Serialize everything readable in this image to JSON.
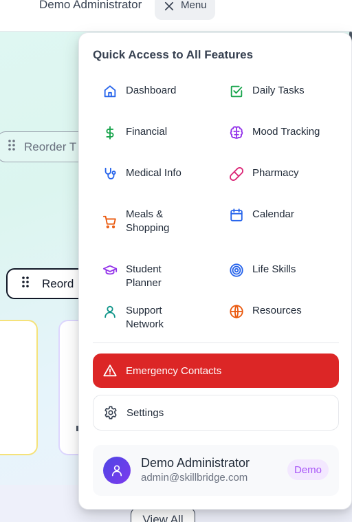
{
  "header": {
    "user_name": "Demo Administrator",
    "menu_label": "Menu"
  },
  "background": {
    "reorder_label_1": "Reorder T",
    "reorder_label_2": "Reord",
    "view_all_label": "View All"
  },
  "menu": {
    "title": "Quick Access to All Features",
    "items": [
      {
        "label": "Dashboard",
        "icon": "home-icon",
        "color": "#2563eb"
      },
      {
        "label": "Daily Tasks",
        "icon": "checkbox-icon",
        "color": "#16a34a"
      },
      {
        "label": "Financial",
        "icon": "dollar-icon",
        "color": "#16a34a"
      },
      {
        "label": "Mood Tracking",
        "icon": "brain-icon",
        "color": "#9333ea"
      },
      {
        "label": "Medical Info",
        "icon": "stethoscope-icon",
        "color": "#2563eb"
      },
      {
        "label": "Pharmacy",
        "icon": "pill-icon",
        "color": "#db2777"
      },
      {
        "label": "Meals & Shopping",
        "icon": "cart-icon",
        "color": "#ea580c"
      },
      {
        "label": "Calendar",
        "icon": "calendar-icon",
        "color": "#2563eb"
      },
      {
        "label": "Student Planner",
        "icon": "graduation-cap-icon",
        "color": "#9333ea"
      },
      {
        "label": "Life Skills",
        "icon": "target-icon",
        "color": "#2563eb"
      },
      {
        "label": "Support Network",
        "icon": "user-icon",
        "color": "#0d9488"
      },
      {
        "label": "Resources",
        "icon": "globe-icon",
        "color": "#ea580c"
      }
    ],
    "emergency_label": "Emergency Contacts",
    "settings_label": "Settings",
    "profile": {
      "name": "Demo Administrator",
      "email": "admin@skillbridge.com",
      "badge": "Demo"
    }
  },
  "colors": {
    "emergency": "#dc2626",
    "badge_bg": "#f3e8ff",
    "badge_text": "#a855f7",
    "avatar": "#4f46e5"
  }
}
